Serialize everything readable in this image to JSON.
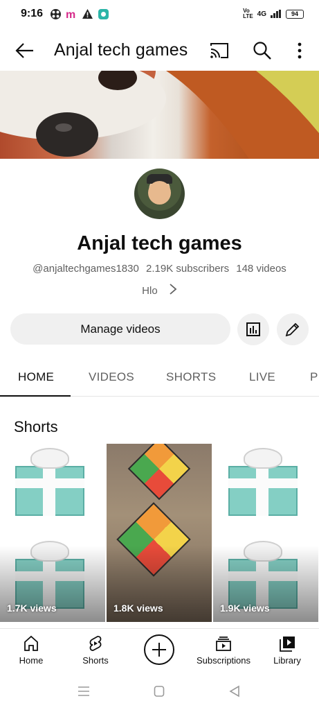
{
  "status_bar": {
    "time": "9:16",
    "network": "4G",
    "battery": "94"
  },
  "header": {
    "title": "Anjal tech games"
  },
  "channel": {
    "name": "Anjal tech games",
    "handle": "@anjaltechgames1830",
    "subscribers": "2.19K subscribers",
    "videos": "148 videos",
    "about": "Hlo"
  },
  "actions": {
    "manage_label": "Manage videos"
  },
  "tabs": [
    {
      "label": "HOME"
    },
    {
      "label": "VIDEOS"
    },
    {
      "label": "SHORTS"
    },
    {
      "label": "LIVE"
    },
    {
      "label": "P"
    }
  ],
  "shorts_section": {
    "title": "Shorts",
    "items": [
      {
        "views": "1.7K views",
        "thumb": "gift-box"
      },
      {
        "views": "1.8K views",
        "thumb": "rubiks-cube"
      },
      {
        "views": "1.9K views",
        "thumb": "gift-box"
      }
    ]
  },
  "bottom_nav": {
    "items": [
      {
        "label": "Home",
        "icon": "home-icon"
      },
      {
        "label": "Shorts",
        "icon": "shorts-icon"
      },
      {
        "label": "",
        "icon": "create-icon"
      },
      {
        "label": "Subscriptions",
        "icon": "subscriptions-icon"
      },
      {
        "label": "Library",
        "icon": "library-icon"
      }
    ]
  },
  "colors": {
    "accent": "#0f0f0f",
    "secondary_text": "#606060",
    "chip_bg": "#f0f0f0"
  }
}
